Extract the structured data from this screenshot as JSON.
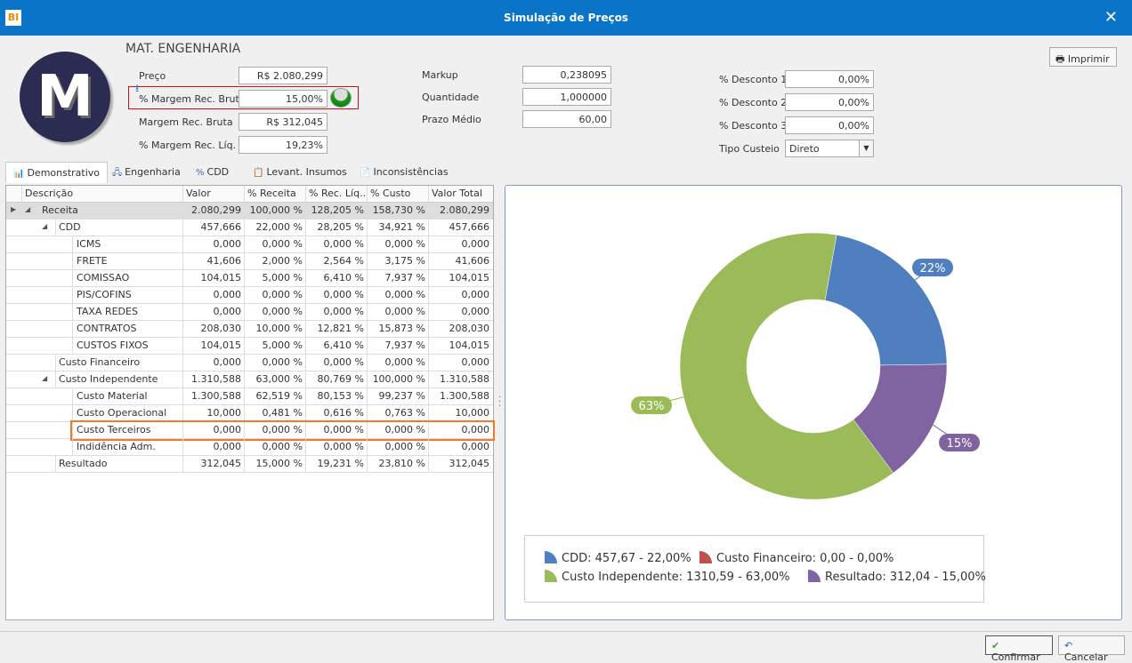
{
  "window": {
    "title": "Simulação de Preços",
    "logo": "BI"
  },
  "header": {
    "avatar_letter": "M",
    "name": "MAT. ENGENHARIA",
    "print_label": "Imprimir"
  },
  "fields_left": [
    {
      "label": "Preço",
      "value": "R$ 2.080,299"
    },
    {
      "label": "% Margem Rec. Bruta",
      "value": "15,00%"
    },
    {
      "label": "Margem Rec. Bruta",
      "value": "R$ 312,045"
    },
    {
      "label": "% Margem Rec. Líq.",
      "value": "19,23%"
    }
  ],
  "fields_mid": [
    {
      "label": "Markup",
      "value": "0,238095"
    },
    {
      "label": "Quantidade",
      "value": "1,000000"
    },
    {
      "label": "Prazo Médio",
      "value": "60,00"
    }
  ],
  "fields_right": [
    {
      "label": "% Desconto 1",
      "value": "0,00%"
    },
    {
      "label": "% Desconto 2",
      "value": "0,00%"
    },
    {
      "label": "% Desconto 3",
      "value": "0,00%"
    },
    {
      "label": "Tipo Custeio",
      "value": "Direto"
    }
  ],
  "tabs": [
    "Demonstrativo",
    "Engenharia",
    "CDD",
    "Levant. Insumos",
    "Inconsistências"
  ],
  "grid": {
    "columns": [
      "Descrição",
      "Valor",
      "% Receita",
      "% Rec. Líq...",
      "% Custo",
      "Valor Total"
    ],
    "rows": [
      {
        "level": 0,
        "expand": true,
        "cells": [
          "Receita",
          "2.080,299",
          "100,000 %",
          "128,205 %",
          "158,730 %",
          "2.080,299"
        ]
      },
      {
        "level": 1,
        "expand": true,
        "cells": [
          "CDD",
          "457,666",
          "22,000 %",
          "28,205 %",
          "34,921 %",
          "457,666"
        ]
      },
      {
        "level": 2,
        "cells": [
          "ICMS",
          "0,000",
          "0,000 %",
          "0,000 %",
          "0,000 %",
          "0,000"
        ]
      },
      {
        "level": 2,
        "cells": [
          "FRETE",
          "41,606",
          "2,000 %",
          "2,564 %",
          "3,175 %",
          "41,606"
        ]
      },
      {
        "level": 2,
        "cells": [
          "COMISSAO",
          "104,015",
          "5,000 %",
          "6,410 %",
          "7,937 %",
          "104,015"
        ]
      },
      {
        "level": 2,
        "cells": [
          "PIS/COFINS",
          "0,000",
          "0,000 %",
          "0,000 %",
          "0,000 %",
          "0,000"
        ]
      },
      {
        "level": 2,
        "cells": [
          "TAXA REDES",
          "0,000",
          "0,000 %",
          "0,000 %",
          "0,000 %",
          "0,000"
        ]
      },
      {
        "level": 2,
        "cells": [
          "CONTRATOS",
          "208,030",
          "10,000 %",
          "12,821 %",
          "15,873 %",
          "208,030"
        ]
      },
      {
        "level": 2,
        "cells": [
          "CUSTOS FIXOS",
          "104,015",
          "5,000 %",
          "6,410 %",
          "7,937 %",
          "104,015"
        ]
      },
      {
        "level": 1,
        "cells": [
          "Custo Financeiro",
          "0,000",
          "0,000 %",
          "0,000 %",
          "0,000 %",
          "0,000"
        ]
      },
      {
        "level": 1,
        "expand": true,
        "cells": [
          "Custo Independente",
          "1.310,588",
          "63,000 %",
          "80,769 %",
          "100,000 %",
          "1.310,588"
        ]
      },
      {
        "level": 2,
        "cells": [
          "Custo Material",
          "1.300,588",
          "62,519 %",
          "80,153 %",
          "99,237 %",
          "1.300,588"
        ]
      },
      {
        "level": 2,
        "cells": [
          "Custo Operacional",
          "10,000",
          "0,481 %",
          "0,616 %",
          "0,763 %",
          "10,000"
        ]
      },
      {
        "level": 2,
        "highlight": true,
        "cells": [
          "Custo Terceiros",
          "0,000",
          "0,000 %",
          "0,000 %",
          "0,000 %",
          "0,000"
        ]
      },
      {
        "level": 2,
        "cells": [
          "Indidência Adm.",
          "0,000",
          "0,000 %",
          "0,000 %",
          "0,000 %",
          "0,000"
        ]
      },
      {
        "level": 1,
        "cells": [
          "Resultado",
          "312,045",
          "15,000 %",
          "19,231 %",
          "23,810 %",
          "312,045"
        ]
      }
    ]
  },
  "chart_data": {
    "type": "pie",
    "donut": true,
    "categories": [
      "CDD",
      "Custo Financeiro",
      "Custo Independente",
      "Resultado"
    ],
    "values": [
      457.67,
      0.0,
      1310.59,
      312.04
    ],
    "percent": [
      22,
      0,
      63,
      15
    ],
    "data_labels": [
      "22%",
      "",
      "63%",
      "15%"
    ],
    "colors": [
      "#4f7fbf",
      "#c0504d",
      "#9bbb59",
      "#8064a2"
    ],
    "legend": [
      "CDD: 457,67 - 22,00%",
      "Custo Financeiro: 0,00 - 0,00%",
      "Custo Independente: 1310,59 - 63,00%",
      "Resultado: 312,04 - 15,00%"
    ],
    "legend_position": "bottom"
  },
  "footer": {
    "confirm": "Confirmar",
    "cancel": "Cancelar"
  }
}
